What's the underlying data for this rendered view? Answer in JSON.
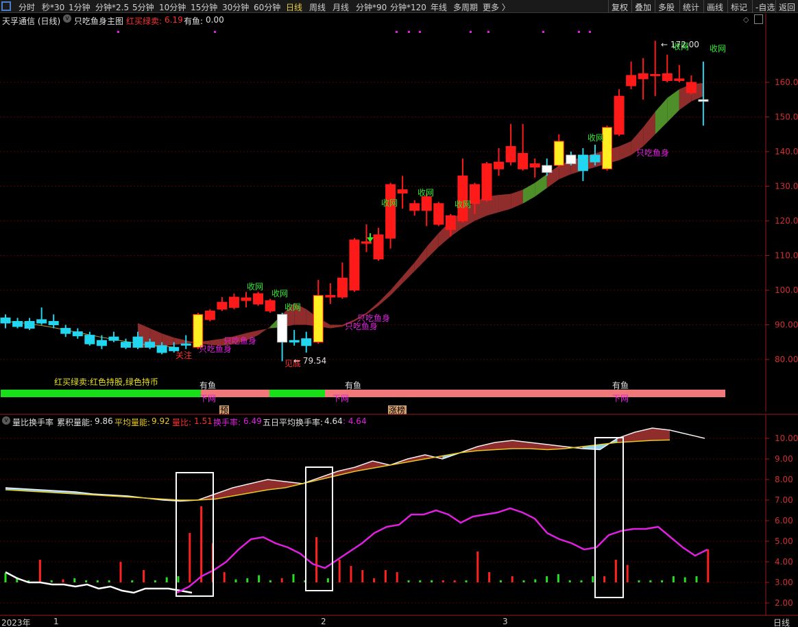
{
  "toolbar": {
    "items": [
      "分时",
      "秒*30",
      "1分钟",
      "分钟*2.5",
      "5分钟",
      "10分钟",
      "15分钟",
      "30分钟",
      "60分钟",
      "日线",
      "周线",
      "月线",
      "分钟*90",
      "分钟*120",
      "年线",
      "多周期",
      "更多 〉"
    ],
    "active": "日线",
    "right_items": [
      "复权",
      "叠加",
      "多股",
      "统计",
      "画线",
      "标记",
      "-自选",
      "返回"
    ]
  },
  "main_panel": {
    "stock_title": "天孚通信 (日线)",
    "indicator_name": "只吃鱼身主图",
    "label_buy_sell": "红买绿卖:",
    "buy_sell_value": "6.19",
    "label_fish": "有鱼:",
    "fish_value": "0.00",
    "legend_text": "红买绿卖:红色持股,绿色持币",
    "price_high_marker": "172.00",
    "price_low_marker": "79.54",
    "y_ticks": [
      "160.0",
      "150.0",
      "140.0",
      "130.0",
      "120.0",
      "110.0",
      "100.0",
      "90.00",
      "80.00"
    ],
    "annotations": {
      "shouwang": "收网",
      "fish_body": "只吃鱼身",
      "attention": "关注",
      "bottom": "见底",
      "has_fish": "有鱼",
      "cast_net": "下网",
      "pre": "预",
      "limit_up": "涨榜"
    }
  },
  "sub_panel": {
    "name": "量比换手率",
    "label_cum": "累积量能:",
    "cum_value": "9.86",
    "label_avg": "平均量能:",
    "avg_value": "9.92",
    "label_ratio": "量比:",
    "ratio_value": "1.51",
    "label_turnover": "换手率:",
    "turnover_value": "6.49",
    "label_5day": "五日平均换手率:",
    "five_day_value": "4.64",
    "extra_value": ": 4.64",
    "y_ticks": [
      "10.00",
      "9.00",
      "8.00",
      "7.00",
      "6.00",
      "5.00",
      "4.00",
      "3.00",
      "2.00"
    ]
  },
  "x_axis": {
    "year": "2023年",
    "months": [
      "1",
      "2",
      "3"
    ],
    "period": "日线"
  },
  "colors": {
    "up": "#ff1a1a",
    "down": "#22d6f0",
    "yellow_bar": "#ffee22",
    "ribbon_red": "#8f2c2c",
    "ribbon_green": "#4f8f2a",
    "magenta": "#e020e0",
    "grid": "#5a0000",
    "axis": "#9b1c1c"
  },
  "chart_data": {
    "type": "candlestick",
    "title": "天孚通信 (日线)",
    "ylim": [
      74,
      178
    ],
    "candles": [
      {
        "o": 92,
        "c": 90.5,
        "h": 93,
        "l": 89,
        "color": "down"
      },
      {
        "o": 91,
        "c": 89.5,
        "h": 92,
        "l": 89,
        "color": "down"
      },
      {
        "o": 91,
        "c": 89,
        "h": 92,
        "l": 88.5,
        "color": "down"
      },
      {
        "o": 91.5,
        "c": 90.5,
        "h": 95,
        "l": 90,
        "color": "down"
      },
      {
        "o": 91,
        "c": 90,
        "h": 93,
        "l": 89,
        "color": "down"
      },
      {
        "o": 89,
        "c": 87.5,
        "h": 90,
        "l": 86.5,
        "color": "down"
      },
      {
        "o": 88,
        "c": 86.8,
        "h": 89,
        "l": 86,
        "color": "down"
      },
      {
        "o": 87,
        "c": 84.5,
        "h": 88,
        "l": 84,
        "color": "down"
      },
      {
        "o": 85.5,
        "c": 84,
        "h": 87,
        "l": 83,
        "color": "down"
      },
      {
        "o": 86.5,
        "c": 85.5,
        "h": 88,
        "l": 85,
        "color": "down"
      },
      {
        "o": 85,
        "c": 83.5,
        "h": 86,
        "l": 83,
        "color": "down"
      },
      {
        "o": 86.5,
        "c": 83.5,
        "h": 88,
        "l": 83,
        "color": "down"
      },
      {
        "o": 85,
        "c": 83.5,
        "h": 86,
        "l": 83,
        "color": "down"
      },
      {
        "o": 84,
        "c": 82,
        "h": 85,
        "l": 81.5,
        "color": "down"
      },
      {
        "o": 83.5,
        "c": 82.5,
        "h": 85,
        "l": 82,
        "color": "down"
      },
      {
        "o": 84.5,
        "c": 84.2,
        "h": 87,
        "l": 83,
        "color": "down"
      },
      {
        "o": 83.5,
        "c": 93,
        "h": 93.5,
        "l": 83,
        "color": "yellow"
      },
      {
        "o": 91.5,
        "c": 94,
        "h": 94.5,
        "l": 91,
        "color": "up"
      },
      {
        "o": 94.5,
        "c": 96.5,
        "h": 98,
        "l": 94,
        "color": "up"
      },
      {
        "o": 95,
        "c": 98,
        "h": 99,
        "l": 94.5,
        "color": "up"
      },
      {
        "o": 97,
        "c": 97.8,
        "h": 99.5,
        "l": 95,
        "color": "up"
      },
      {
        "o": 96,
        "c": 99,
        "h": 99.5,
        "l": 95.5,
        "color": "up"
      },
      {
        "o": 94,
        "c": 97,
        "h": 97.5,
        "l": 93.5,
        "color": "up"
      },
      {
        "o": 93,
        "c": 85,
        "h": 93.5,
        "l": 79.5,
        "color": "white"
      },
      {
        "o": 85.5,
        "c": 85,
        "h": 88.5,
        "l": 84,
        "color": "down"
      },
      {
        "o": 86,
        "c": 84,
        "h": 88,
        "l": 82,
        "color": "down"
      },
      {
        "o": 85,
        "c": 98.5,
        "h": 103,
        "l": 84.5,
        "color": "yellow"
      },
      {
        "o": 98,
        "c": 98.5,
        "h": 102,
        "l": 96,
        "color": "up"
      },
      {
        "o": 98,
        "c": 103.5,
        "h": 108,
        "l": 97.5,
        "color": "up"
      },
      {
        "o": 100,
        "c": 114.5,
        "h": 115,
        "l": 99.5,
        "color": "up"
      },
      {
        "o": 113.5,
        "c": 114,
        "h": 119,
        "l": 111,
        "color": "up"
      },
      {
        "o": 109,
        "c": 116,
        "h": 118,
        "l": 108.5,
        "color": "up"
      },
      {
        "o": 115,
        "c": 130.5,
        "h": 131,
        "l": 112,
        "color": "up"
      },
      {
        "o": 128,
        "c": 129,
        "h": 133,
        "l": 123.5,
        "color": "up"
      },
      {
        "o": 123,
        "c": 125,
        "h": 126,
        "l": 121.5,
        "color": "up"
      },
      {
        "o": 123,
        "c": 127,
        "h": 128,
        "l": 118.5,
        "color": "up"
      },
      {
        "o": 119,
        "c": 125,
        "h": 125.5,
        "l": 118.5,
        "color": "up"
      },
      {
        "o": 117.5,
        "c": 121.5,
        "h": 122,
        "l": 115.5,
        "color": "up"
      },
      {
        "o": 120,
        "c": 133,
        "h": 138,
        "l": 119.5,
        "color": "up"
      },
      {
        "o": 125,
        "c": 130.5,
        "h": 131,
        "l": 122,
        "color": "up"
      },
      {
        "o": 126,
        "c": 136.5,
        "h": 137,
        "l": 125.5,
        "color": "up"
      },
      {
        "o": 135,
        "c": 137,
        "h": 141,
        "l": 133,
        "color": "up"
      },
      {
        "o": 137,
        "c": 141.5,
        "h": 148,
        "l": 136,
        "color": "up"
      },
      {
        "o": 135,
        "c": 139.5,
        "h": 148,
        "l": 134.5,
        "color": "up"
      },
      {
        "o": 135.5,
        "c": 136.5,
        "h": 138,
        "l": 132.5,
        "color": "up"
      },
      {
        "o": 136,
        "c": 134,
        "h": 138,
        "l": 133,
        "color": "white"
      },
      {
        "o": 136,
        "c": 143,
        "h": 145,
        "l": 135.5,
        "color": "yellow"
      },
      {
        "o": 136.5,
        "c": 139,
        "h": 140,
        "l": 136,
        "color": "white"
      },
      {
        "o": 139,
        "c": 134.5,
        "h": 141,
        "l": 131.5,
        "color": "down"
      },
      {
        "o": 139,
        "c": 137,
        "h": 142,
        "l": 136,
        "color": "down"
      },
      {
        "o": 135,
        "c": 147,
        "h": 147.5,
        "l": 134.5,
        "color": "yellow"
      },
      {
        "o": 145,
        "c": 156,
        "h": 158,
        "l": 144.5,
        "color": "up"
      },
      {
        "o": 159,
        "c": 162,
        "h": 166,
        "l": 158,
        "color": "up"
      },
      {
        "o": 161,
        "c": 162.5,
        "h": 167,
        "l": 155,
        "color": "up"
      },
      {
        "o": 162,
        "c": 162.3,
        "h": 172,
        "l": 156,
        "color": "up"
      },
      {
        "o": 160.5,
        "c": 162.5,
        "h": 168,
        "l": 160,
        "color": "up"
      },
      {
        "o": 160.5,
        "c": 161,
        "h": 165,
        "l": 160,
        "color": "up"
      },
      {
        "o": 157,
        "c": 160,
        "h": 162,
        "l": 156.5,
        "color": "up"
      },
      {
        "o": 155,
        "c": 154.5,
        "h": 166,
        "l": 147.5,
        "color": "white"
      }
    ],
    "ribbon_upper": [
      90.5,
      89,
      87.5,
      86.3,
      85.5,
      84.7,
      84.2,
      84,
      84.4,
      85.5,
      87,
      89.5,
      93,
      96.3,
      94.5,
      92,
      90,
      90,
      91.5,
      93.5,
      96.5,
      100,
      104,
      108,
      112.5,
      116.5,
      120,
      123,
      125.5,
      127,
      127.5,
      127.8,
      129,
      131,
      133.5,
      136,
      137.5,
      138.5,
      139.5,
      140.5,
      141.5,
      143,
      147,
      151.5,
      155.5,
      158,
      159.5,
      159.8
    ],
    "ribbon_lower": [
      83.3,
      83.5,
      83.8,
      84.2,
      84.6,
      85,
      85.5,
      86,
      86.7,
      87.6,
      88.4,
      89,
      89.3,
      90,
      90,
      89.5,
      89,
      89.5,
      91,
      93,
      95.5,
      98.5,
      102,
      105.5,
      109,
      112.5,
      115.5,
      118,
      120,
      121.5,
      122.5,
      123.5,
      125,
      127,
      129.5,
      132,
      133.5,
      134.5,
      135.5,
      136.5,
      137.5,
      139,
      141.5,
      145,
      148.5,
      152,
      154.5,
      156
    ],
    "ribbon_colors": [
      "r",
      "r",
      "r",
      "r",
      "r",
      "r",
      "r",
      "r",
      "r",
      "r",
      "r",
      "g",
      "r",
      "r",
      "r",
      "r",
      "r",
      "r",
      "r",
      "r",
      "r",
      "r",
      "r",
      "r",
      "r",
      "r",
      "r",
      "r",
      "r",
      "r",
      "r",
      "r",
      "g",
      "g",
      "r",
      "r",
      "r",
      "r",
      "r",
      "r",
      "r",
      "r",
      "r",
      "g",
      "g",
      "r",
      "r",
      "g"
    ],
    "ma_line": [
      91,
      90.7,
      90.3,
      89.8,
      89.2,
      88.5,
      87.8,
      87.1,
      86.4,
      85.8,
      85.2,
      84.6,
      84.1,
      83.8,
      83.6
    ],
    "sub": {
      "ylim": [
        1.6,
        10.8
      ],
      "white_line": [
        3.5,
        3.2,
        3,
        3,
        2.9,
        2.9,
        2.8,
        2.9,
        2.7,
        2.8,
        2.6,
        2.5,
        2.7,
        2.7,
        2.7,
        2.6,
        2.5
      ],
      "magenta_line": [
        2.5,
        2.8,
        3.3,
        3.6,
        4,
        4.6,
        5.1,
        5.2,
        4.9,
        4.7,
        4.4,
        3.9,
        3.7,
        4.1,
        4.5,
        4.9,
        5.4,
        5.7,
        5.8,
        6.3,
        6.3,
        6.5,
        6.3,
        5.9,
        6.2,
        6.3,
        6.4,
        6.6,
        6.4,
        6.1,
        5.4,
        5.1,
        4.9,
        4.6,
        4.7,
        5.3,
        5.5,
        5.6,
        5.6,
        5.7,
        5.2,
        4.7,
        4.3,
        4.6
      ],
      "upper_line": [
        7.6,
        7.55,
        7.5,
        7.45,
        7.4,
        7.3,
        7.25,
        7.2,
        7.1,
        7.0,
        6.95,
        7.0,
        7.3,
        7.6,
        7.8,
        8.0,
        7.9,
        7.8,
        8.1,
        8.4,
        8.6,
        8.9,
        8.7,
        9.0,
        9.2,
        9.0,
        9.3,
        9.6,
        9.8,
        9.9,
        9.8,
        9.7,
        9.6,
        9.5,
        9.45,
        10.0,
        10.3,
        10.5,
        10.4,
        10.2,
        10.0
      ],
      "lower_line": [
        7.5,
        7.45,
        7.4,
        7.35,
        7.3,
        7.25,
        7.2,
        7.15,
        7.1,
        7.05,
        7.0,
        7.0,
        7.05,
        7.2,
        7.35,
        7.5,
        7.6,
        7.8,
        8.0,
        8.2,
        8.4,
        8.55,
        8.7,
        8.85,
        9.0,
        9.15,
        9.3,
        9.4,
        9.45,
        9.5,
        9.5,
        9.45,
        9.5,
        9.6,
        9.7,
        9.8,
        9.85,
        9.9,
        9.92
      ],
      "volume_bars": [
        {
          "v": 0.45,
          "c": "g"
        },
        {
          "v": 0.25,
          "c": "g"
        },
        {
          "v": 0.1,
          "c": "g"
        },
        {
          "v": 1.1,
          "c": "r"
        },
        {
          "v": 0.1,
          "c": "g"
        },
        {
          "v": 0.15,
          "c": "r"
        },
        {
          "v": 0.2,
          "c": "g"
        },
        {
          "v": 0.1,
          "c": "g"
        },
        {
          "v": 0.1,
          "c": "g"
        },
        {
          "v": 0.1,
          "c": "g"
        },
        {
          "v": 1.0,
          "c": "r"
        },
        {
          "v": 0.1,
          "c": "g"
        },
        {
          "v": 0.6,
          "c": "r"
        },
        {
          "v": 0.1,
          "c": "g"
        },
        {
          "v": 0.25,
          "c": "g"
        },
        {
          "v": 0.3,
          "c": "g"
        },
        {
          "v": 2.4,
          "c": "r"
        },
        {
          "v": 3.7,
          "c": "r"
        },
        {
          "v": 1.9,
          "c": "r"
        },
        {
          "v": 0.5,
          "c": "r"
        },
        {
          "v": 0.15,
          "c": "g"
        },
        {
          "v": 0.2,
          "c": "g"
        },
        {
          "v": 0.35,
          "c": "g"
        },
        {
          "v": 0.1,
          "c": "g"
        },
        {
          "v": 0.2,
          "c": "r"
        },
        {
          "v": 0.4,
          "c": "g"
        },
        {
          "v": 0.1,
          "c": "g"
        },
        {
          "v": 2.2,
          "c": "r"
        },
        {
          "v": 0.2,
          "c": "g"
        },
        {
          "v": 1.1,
          "c": "r"
        },
        {
          "v": 0.8,
          "c": "r"
        },
        {
          "v": 0.6,
          "c": "r"
        },
        {
          "v": 0.2,
          "c": "r"
        },
        {
          "v": 0.6,
          "c": "r"
        },
        {
          "v": 0.5,
          "c": "r"
        },
        {
          "v": 0.1,
          "c": "g"
        },
        {
          "v": 0.1,
          "c": "g"
        },
        {
          "v": 0.1,
          "c": "g"
        },
        {
          "v": 0.1,
          "c": "r"
        },
        {
          "v": 0.1,
          "c": "r"
        },
        {
          "v": 0.1,
          "c": "g"
        },
        {
          "v": 1.5,
          "c": "r"
        },
        {
          "v": 0.5,
          "c": "r"
        },
        {
          "v": 0.1,
          "c": "g"
        },
        {
          "v": 0.3,
          "c": "r"
        },
        {
          "v": 0.1,
          "c": "g"
        },
        {
          "v": 0.15,
          "c": "g"
        },
        {
          "v": 0.3,
          "c": "g"
        },
        {
          "v": 0.4,
          "c": "g"
        },
        {
          "v": 0.1,
          "c": "g"
        },
        {
          "v": 0.1,
          "c": "g"
        },
        {
          "v": 0.3,
          "c": "g"
        },
        {
          "v": 0.3,
          "c": "r"
        },
        {
          "v": 1.1,
          "c": "r"
        },
        {
          "v": 0.85,
          "c": "r"
        },
        {
          "v": 0.1,
          "c": "g"
        },
        {
          "v": 0.1,
          "c": "g"
        },
        {
          "v": 0.1,
          "c": "g"
        },
        {
          "v": 0.3,
          "c": "g"
        },
        {
          "v": 0.25,
          "c": "g"
        },
        {
          "v": 0.3,
          "c": "g"
        },
        {
          "v": 1.6,
          "c": "r"
        }
      ]
    }
  }
}
